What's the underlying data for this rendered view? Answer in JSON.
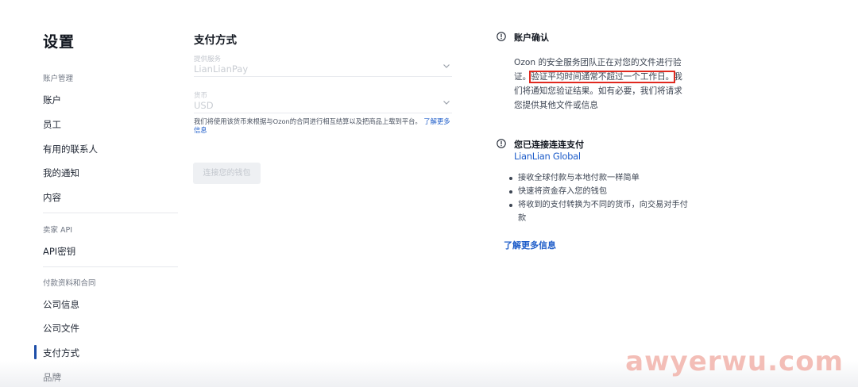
{
  "page": {
    "title": "设置"
  },
  "sidebar": {
    "sections": [
      {
        "label": "账户管理",
        "items": [
          "账户",
          "员工",
          "有用的联系人",
          "我的通知",
          "内容"
        ]
      },
      {
        "label": "卖家 API",
        "items": [
          "API密钥"
        ]
      },
      {
        "label": "付款资料和合同",
        "items": [
          "公司信息",
          "公司文件",
          "支付方式",
          "品牌"
        ]
      }
    ],
    "active_item": "支付方式"
  },
  "payment": {
    "title": "支付方式",
    "provider_field": {
      "label": "提供服务",
      "value": "LianLianPay"
    },
    "currency_field": {
      "label": "货币",
      "value": "USD"
    },
    "hint_text": "我们将使用该货币来根据与Ozon的合同进行相互结算以及把商品上载到平台。",
    "hint_link": "了解更多信息",
    "connect_button": "连接您的钱包"
  },
  "verification": {
    "heading": "账户确认",
    "text_before": "Ozon 的安全服务团队正在对您的文件进行验证。",
    "text_highlight": "验证平均时间通常不超过一个工作日。",
    "text_after": "我们将通知您验证结果。如有必要，我们将请求您提供其他文件或信息"
  },
  "connected": {
    "heading": "您已连接连连支付",
    "logo_text": "LianLian Global",
    "bullets": [
      "接收全球付款与本地付款一样简单",
      "快速将资金存入您的钱包",
      "将收到的支付转换为不同的货币，向交易对手付款"
    ],
    "learn_more": "了解更多信息"
  },
  "watermark": "awyerwu.com",
  "colors": {
    "accent": "#1d5cc9",
    "highlight_box": "#e0291f",
    "active_bar": "#1d4ea8"
  }
}
